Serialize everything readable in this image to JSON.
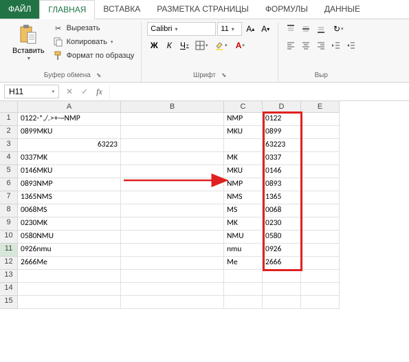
{
  "tabs": {
    "file": "ФАЙЛ",
    "home": "ГЛАВНАЯ",
    "insert": "ВСТАВКА",
    "pagelayout": "РАЗМЕТКА СТРАНИЦЫ",
    "formulas": "ФОРМУЛЫ",
    "data": "ДАННЫЕ"
  },
  "clipboard": {
    "paste": "Вставить",
    "cut": "Вырезать",
    "copy": "Копировать",
    "format_painter": "Формат по образцу",
    "group": "Буфер обмена"
  },
  "font": {
    "name": "Calibri",
    "size": "11",
    "group": "Шрифт",
    "bold": "Ж",
    "italic": "К",
    "underline": "Ч"
  },
  "align": {
    "group_partial": "Выр"
  },
  "namebox": "H11",
  "fx": "fx",
  "columns": [
    "A",
    "B",
    "C",
    "D",
    "E"
  ],
  "rows": [
    {
      "r": "1",
      "A": "0122-*,/.>+-~NMP",
      "B": "",
      "C": "NMP",
      "D": "0122",
      "E": ""
    },
    {
      "r": "2",
      "A": "0899MKU",
      "B": "",
      "C": "MKU",
      "D": "0899",
      "E": ""
    },
    {
      "r": "3",
      "A": "63223",
      "A_right": true,
      "B": "",
      "C": "",
      "D": "63223",
      "E": ""
    },
    {
      "r": "4",
      "A": "0337MK",
      "B": "",
      "C": "MK",
      "D": "0337",
      "E": ""
    },
    {
      "r": "5",
      "A": "0146MKU",
      "B": "",
      "C": "MKU",
      "D": "0146",
      "E": ""
    },
    {
      "r": "6",
      "A": "0893NMP",
      "B": "",
      "C": "NMP",
      "D": "0893",
      "E": ""
    },
    {
      "r": "7",
      "A": "1365NMS",
      "B": "",
      "C": "NMS",
      "D": "1365",
      "E": ""
    },
    {
      "r": "8",
      "A": "0068MS",
      "B": "",
      "C": "MS",
      "D": "0068",
      "E": ""
    },
    {
      "r": "9",
      "A": "0230MK",
      "B": "",
      "C": "MK",
      "D": "0230",
      "E": ""
    },
    {
      "r": "10",
      "A": "0580NMU",
      "B": "",
      "C": "NMU",
      "D": "0580",
      "E": ""
    },
    {
      "r": "11",
      "A": "0926nmu",
      "B": "",
      "C": "nmu",
      "D": "0926",
      "E": ""
    },
    {
      "r": "12",
      "A": "2666Me",
      "B": "",
      "C": "Me",
      "D": "2666",
      "E": ""
    },
    {
      "r": "13",
      "A": "",
      "B": "",
      "C": "",
      "D": "",
      "E": ""
    },
    {
      "r": "14",
      "A": "",
      "B": "",
      "C": "",
      "D": "",
      "E": ""
    },
    {
      "r": "15",
      "A": "",
      "B": "",
      "C": "",
      "D": "",
      "E": ""
    }
  ],
  "chart_data": {
    "type": "table",
    "description": "Spreadsheet extracting leading digits from mixed text codes",
    "columns": [
      "A (source)",
      "C (suffix)",
      "D (leading digits)"
    ],
    "rows": [
      [
        "0122-*,/.>+-~NMP",
        "NMP",
        "0122"
      ],
      [
        "0899MKU",
        "MKU",
        "0899"
      ],
      [
        "63223",
        "",
        "63223"
      ],
      [
        "0337MK",
        "MK",
        "0337"
      ],
      [
        "0146MKU",
        "MKU",
        "0146"
      ],
      [
        "0893NMP",
        "NMP",
        "0893"
      ],
      [
        "1365NMS",
        "NMS",
        "1365"
      ],
      [
        "0068MS",
        "MS",
        "0068"
      ],
      [
        "0230MK",
        "MK",
        "0230"
      ],
      [
        "0580NMU",
        "NMU",
        "0580"
      ],
      [
        "0926nmu",
        "nmu",
        "0926"
      ],
      [
        "2666Me",
        "Me",
        "2666"
      ]
    ]
  }
}
